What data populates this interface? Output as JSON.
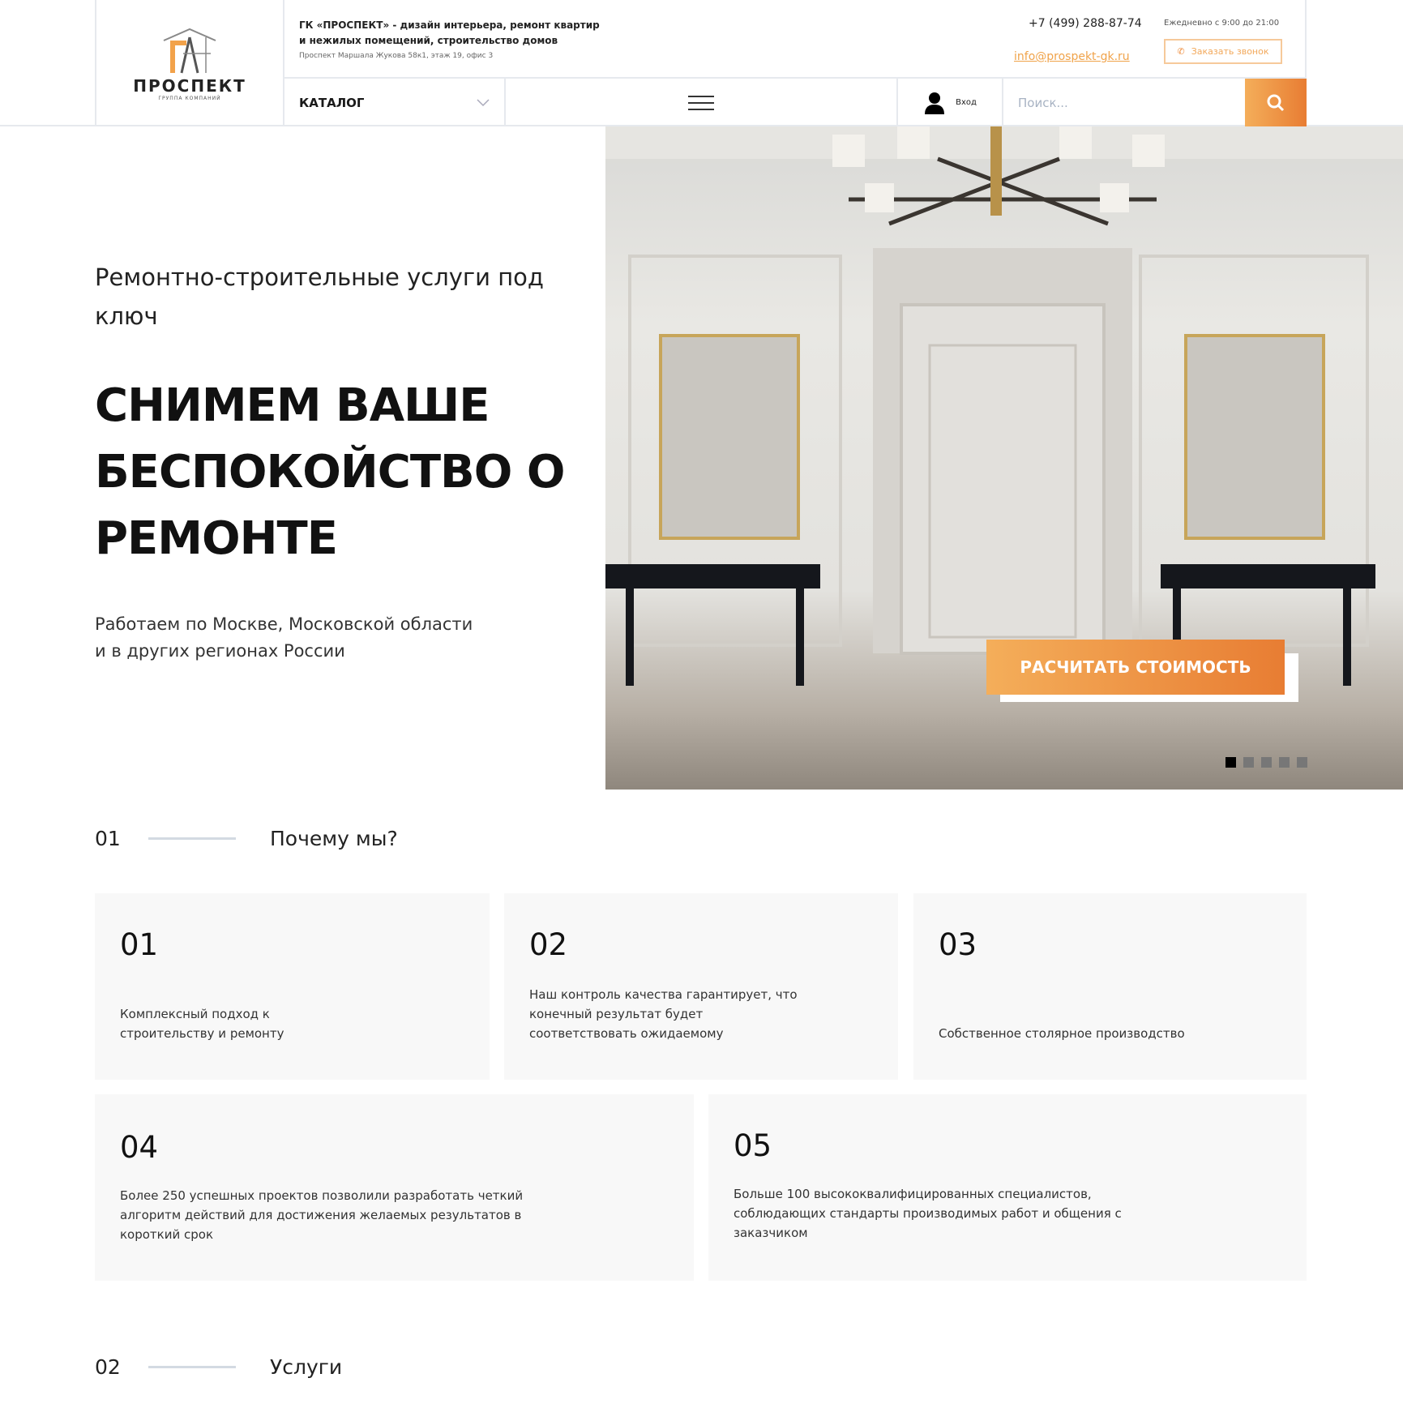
{
  "header": {
    "logo_name": "ПРОСПЕКТ",
    "logo_sub": "ГРУППА КОМПАНИЙ",
    "description": "ГК «ПРОСПЕКТ» - дизайн интерьера, ремонт квартир и нежилых помещений, строительство домов",
    "address": "Проспект Маршала Жукова 58к1, этаж 19, офис 3",
    "phone": "+7 (499) 288-87-74",
    "hours": "Ежедневно с 9:00 до 21:00",
    "email": "info@prospekt-gk.ru",
    "call_button": "Заказать звонок",
    "catalog": "КАТАЛОГ",
    "login": "Вход",
    "search_placeholder": "Поиск..."
  },
  "hero": {
    "subtitle": "Ремонтно-строительные услуги под ключ",
    "title": "Снимем ваше беспокойство о ремонте",
    "regions": "Работаем по Москве, Московской области и в других регионах России",
    "cta": "РАСЧИТАТЬ СТОИМОСТЬ",
    "slides": 5,
    "active_slide": 1
  },
  "why": {
    "num": "01",
    "title": "Почему мы?",
    "cards": [
      {
        "n": "01",
        "text": "Комплексный подход к строительству и ремонту"
      },
      {
        "n": "02",
        "text": "Наш контроль качества гарантирует, что конечный результат будет соответствовать ожидаемому"
      },
      {
        "n": "03",
        "text": "Собственное столярное производство"
      },
      {
        "n": "04",
        "text": "Более 250 успешных проектов позволили разработать четкий алгоритм действий для достижения желаемых результатов в короткий срок"
      },
      {
        "n": "05",
        "text": "Больше 100 высококвалифицированных специалистов, соблюдающих стандарты производимых работ и общения с заказчиком"
      }
    ]
  },
  "services": {
    "num": "02",
    "title": "Услуги"
  },
  "colors": {
    "accent": "#f08a3c",
    "accent_light": "#f4ae5a"
  }
}
